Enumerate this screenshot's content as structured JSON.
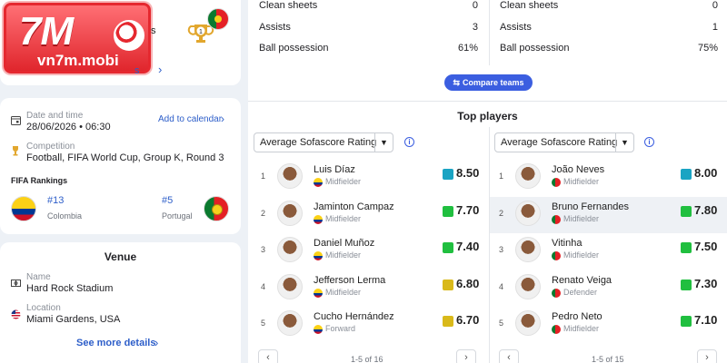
{
  "header": {
    "watermark_brand": "7M",
    "watermark_domain": "vn7m.mobi",
    "fragment_s": "s",
    "fragment_s2": "s",
    "trophy_count": "1"
  },
  "info": {
    "date_label": "Date and time",
    "date_value": "28/06/2026",
    "time_value": "06:30",
    "add_calendar": "Add to calendar",
    "competition_label": "Competition",
    "competition_value": "Football, FIFA World Cup, Group K, Round 3",
    "rankings_title": "FIFA Rankings",
    "home_rank": "#13",
    "home_team": "Colombia",
    "away_rank": "#5",
    "away_team": "Portugal"
  },
  "venue": {
    "title": "Venue",
    "name_label": "Name",
    "name_value": "Hard Rock Stadium",
    "location_label": "Location",
    "location_value": "Miami Gardens, USA",
    "more": "See more details"
  },
  "stats": {
    "left": [
      {
        "label": "Clean sheets",
        "value": "0"
      },
      {
        "label": "Assists",
        "value": "3"
      },
      {
        "label": "Ball possession",
        "value": "61%"
      }
    ],
    "right": [
      {
        "label": "Clean sheets",
        "value": "0"
      },
      {
        "label": "Assists",
        "value": "1"
      },
      {
        "label": "Ball possession",
        "value": "75%"
      }
    ],
    "compare_label": "Compare teams"
  },
  "top_players": {
    "title": "Top players",
    "left_select": "Average Sofascore Rating",
    "right_select": "Average Sofascore Rating",
    "left": [
      {
        "rank": "1",
        "name": "Luis Díaz",
        "pos": "Midfielder",
        "rating": "8.50"
      },
      {
        "rank": "2",
        "name": "Jaminton Campaz",
        "pos": "Midfielder",
        "rating": "7.70"
      },
      {
        "rank": "3",
        "name": "Daniel Muñoz",
        "pos": "Midfielder",
        "rating": "7.40"
      },
      {
        "rank": "4",
        "name": "Jefferson Lerma",
        "pos": "Midfielder",
        "rating": "6.80"
      },
      {
        "rank": "5",
        "name": "Cucho Hernández",
        "pos": "Forward",
        "rating": "6.70"
      }
    ],
    "right": [
      {
        "rank": "1",
        "name": "João Neves",
        "pos": "Midfielder",
        "rating": "8.00"
      },
      {
        "rank": "2",
        "name": "Bruno Fernandes",
        "pos": "Midfielder",
        "rating": "7.80"
      },
      {
        "rank": "3",
        "name": "Vitinha",
        "pos": "Midfielder",
        "rating": "7.50"
      },
      {
        "rank": "4",
        "name": "Renato Veiga",
        "pos": "Defender",
        "rating": "7.30"
      },
      {
        "rank": "5",
        "name": "Pedro Neto",
        "pos": "Midfielder",
        "rating": "7.10"
      }
    ],
    "left_pager": "1-5 of 16",
    "right_pager": "1-5 of 15"
  },
  "colors": {
    "rating_teal": "#1aa4c3",
    "rating_green": "#20bf3f",
    "rating_yellow": "#d9b91a",
    "link_blue": "#2d5ec9",
    "accent_blue": "#3b5ee0"
  },
  "icons": {
    "calendar": "calendar-icon",
    "trophy": "trophy-icon",
    "stadium": "stadium-icon",
    "location": "us-flag-icon"
  }
}
